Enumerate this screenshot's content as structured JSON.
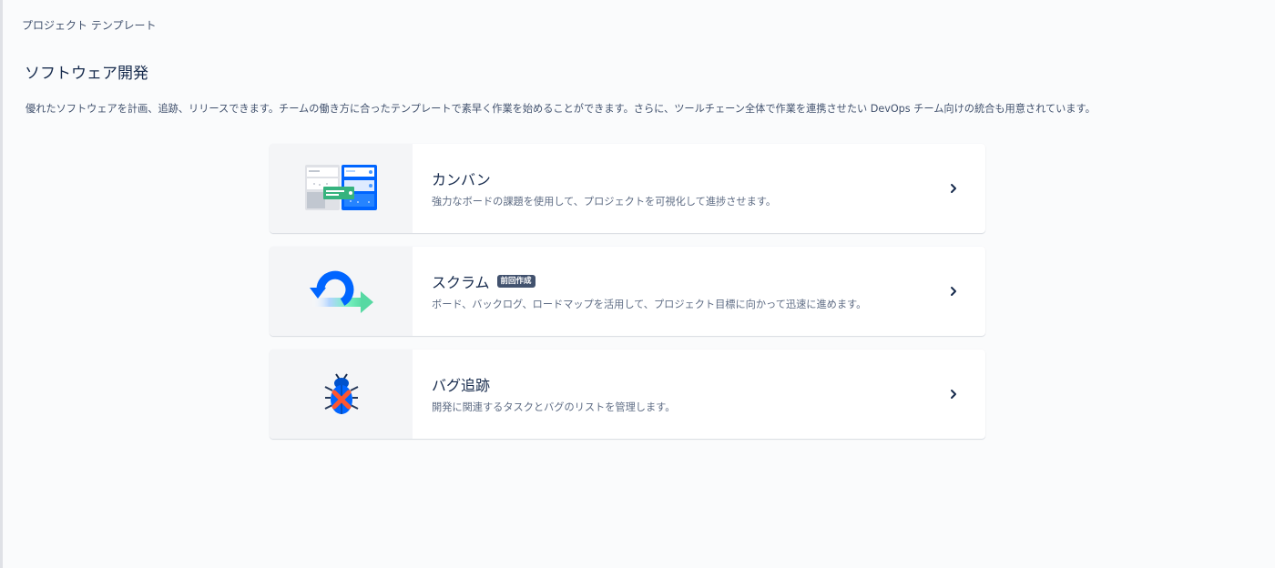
{
  "breadcrumb": "プロジェクト テンプレート",
  "page_title": "ソフトウェア開発",
  "description": "優れたソフトウェアを計画、追跡、リリースできます。チームの働き方に合ったテンプレートで素早く作業を始めることができます。さらに、ツールチェーン全体で作業を連携させたい DevOps チーム向けの統合も用意されています。",
  "templates": [
    {
      "title": "カンバン",
      "badge": "",
      "description": "強力なボードの課題を使用して、プロジェクトを可視化して進捗させます。",
      "icon": "kanban-board-icon"
    },
    {
      "title": "スクラム",
      "badge": "前回作成",
      "description": "ボード、バックログ、ロードマップを活用して、プロジェクト目標に向かって迅速に進めます。",
      "icon": "scrum-cycle-icon"
    },
    {
      "title": "バグ追跡",
      "badge": "",
      "description": "開発に関連するタスクとバグのリストを管理します。",
      "icon": "bug-icon"
    }
  ],
  "colors": {
    "accent_blue": "#0065ff",
    "accent_green": "#36b37e",
    "bug_red": "#ff5630"
  }
}
